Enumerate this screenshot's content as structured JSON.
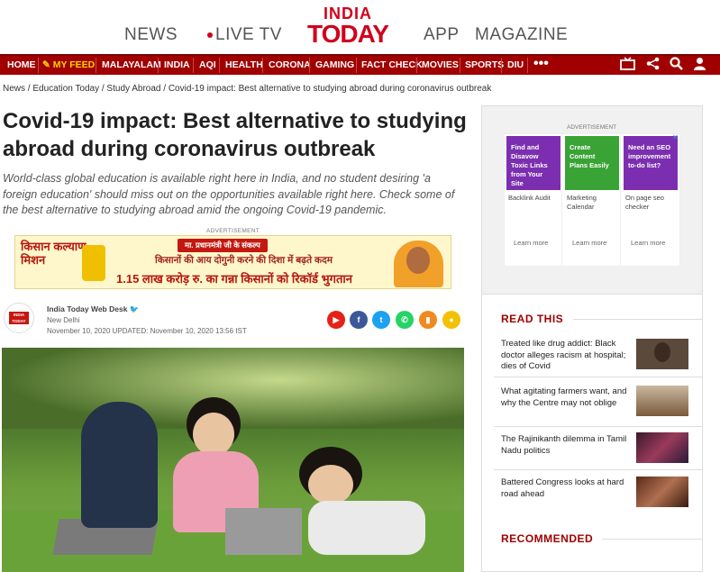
{
  "topnav": {
    "news": "NEWS",
    "livetv": "LIVE TV",
    "app": "APP",
    "magazine": "MAGAZINE"
  },
  "logo": {
    "line1": "INDIA",
    "line2": "TODAY"
  },
  "nav": [
    "HOME",
    "MY FEED",
    "MALAYALAM",
    "INDIA",
    "AQI",
    "HEALTH",
    "CORONA",
    "GAMING",
    "FACT CHECK",
    "MOVIES",
    "SPORTS",
    "DIU"
  ],
  "breadcrumb": "News / Education Today / Study Abroad / Covid-19 impact: Best alternative to studying abroad during coronavirus outbreak",
  "headline": "Covid-19 impact: Best alternative to studying abroad during coronavirus outbreak",
  "summary": "World-class global education is available right here in India, and no student desiring 'a foreign education' should miss out on the opportunities available right here. Check some of the best alternative to studying abroad amid the ongoing Covid-19 pandemic.",
  "ad_label": "ADVERTISEMENT",
  "hindi_ad": {
    "brand": "किसान कल्याण मिशन",
    "pill": "मा. प्रधानमंत्री जी के संकल्प",
    "middle": "किसानों की आय दोगुनी करने की दिशा में बढ़ते कदम",
    "big": "1.15 लाख करोड़ रु. का गन्ना किसानों को रिकॉर्ड भुगतान"
  },
  "author": {
    "name": "India Today Web Desk",
    "location": "New Delhi",
    "date": "November 10, 2020 UPDATED: November 10, 2020 13:56 IST",
    "logo_line1": "INDIA",
    "logo_line2": "TODAY"
  },
  "side_ad": {
    "label": "ADVERTISEMENT",
    "cards": [
      {
        "headline": "Find and Disavow Toxic Links from Your Site",
        "title": "Backlink Audit",
        "more": "Learn more",
        "color": "#7b2fb0"
      },
      {
        "headline": "Create Content Plans Easily",
        "title": "Marketing Calendar",
        "more": "Learn more",
        "color": "#3aa335"
      },
      {
        "headline": "Need an SEO improvement to-do list?",
        "title": "On page seo checker",
        "more": "Learn more",
        "color": "#7b2fb0"
      }
    ]
  },
  "read_this": {
    "heading": "READ THIS",
    "items": [
      {
        "text": "Treated like drug addict: Black doctor alleges racism at hospital; dies of Covid",
        "thumb": "#5b4a3c"
      },
      {
        "text": "What agitating farmers want, and why the Centre may not oblige",
        "thumb": "#9a7b5a"
      },
      {
        "text": "The Rajinikanth dilemma in Tamil Nadu politics",
        "thumb": "#6b3248"
      },
      {
        "text": "Battered Congress looks at hard road ahead",
        "thumb": "#7a4a38"
      }
    ]
  },
  "recommended": {
    "heading": "RECOMMENDED"
  }
}
